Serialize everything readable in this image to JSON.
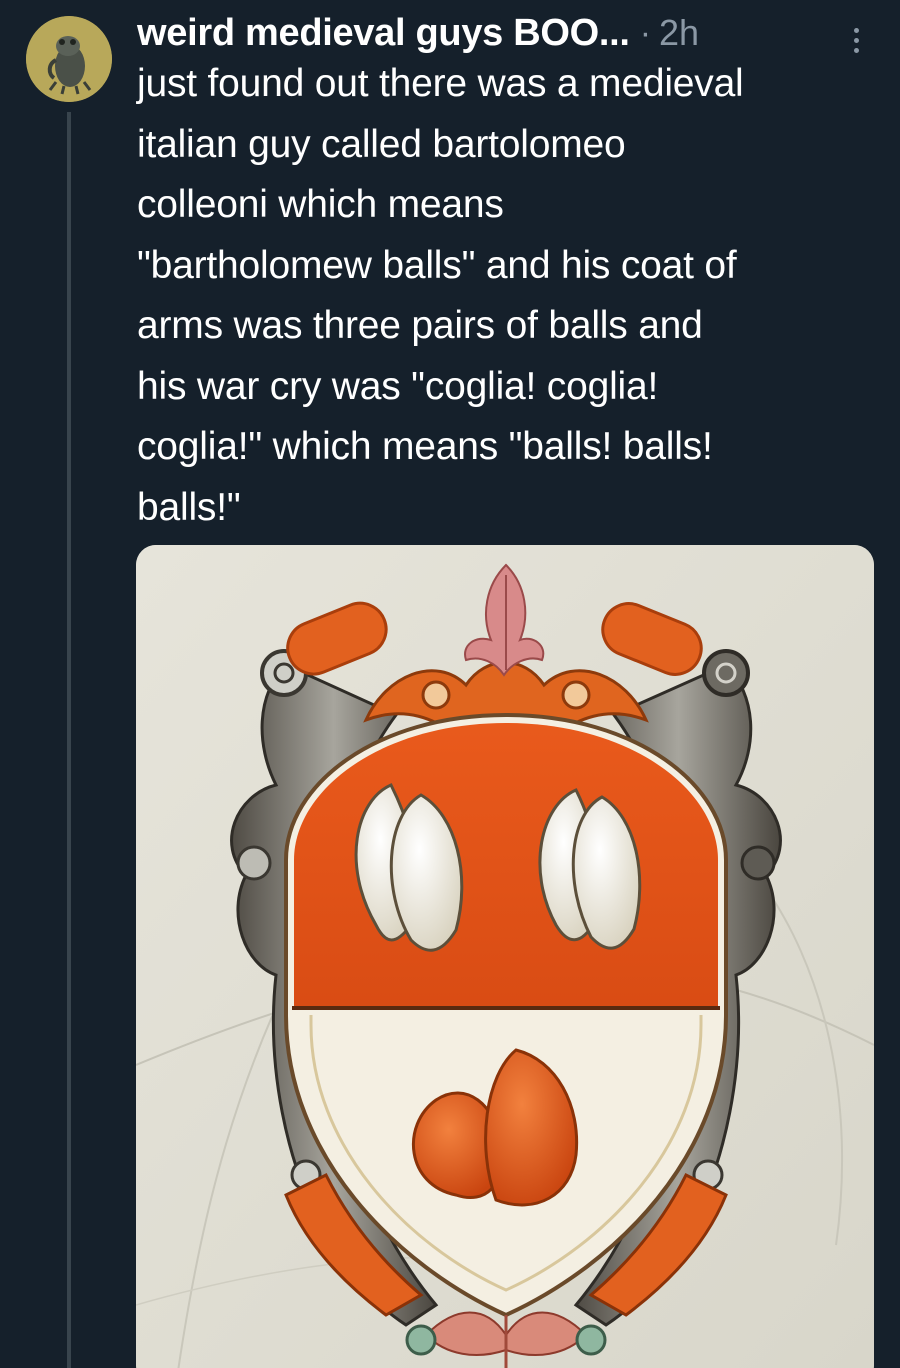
{
  "tweet": {
    "author": {
      "display_name": "weird medieval guys BOO...",
      "avatar_icon": "frog-avatar-icon"
    },
    "separator": "·",
    "timestamp": "2h",
    "more_icon": "more-vertical-icon",
    "text": "just found out there was a medieval\nitalian guy called bartolomeo\ncolleoni which means\n\"bartholomew balls\" and his coat of\narms was three pairs of balls and\nhis war cry was \"coglia! coglia!\ncoglia!\" which means \"balls! balls!\nballs!\"",
    "media": {
      "kind": "image",
      "subject": "coat-of-arms-illustration"
    }
  },
  "colors": {
    "background": "#15202b",
    "text_primary": "#ffffff",
    "text_secondary": "#8b98a5",
    "thread_line": "#38444d",
    "heraldic_orange": "#e2571c",
    "heraldic_white": "#f4efe2"
  }
}
